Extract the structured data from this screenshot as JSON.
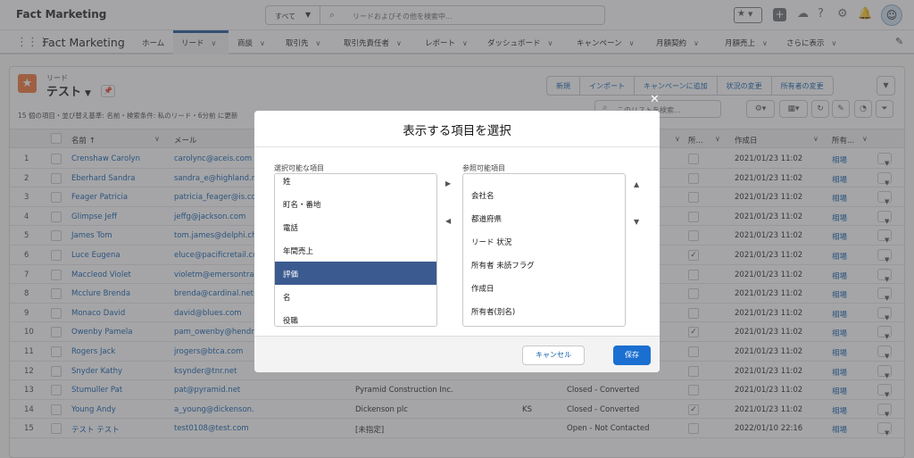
{
  "header": {
    "org_name": "Fact Marketing",
    "search_scope": "すべて",
    "search_placeholder": "リードおよびその他を検索中..."
  },
  "nav": {
    "app_name": "Fact Marketing",
    "tabs": [
      "ホーム",
      "リード",
      "商談",
      "取引先",
      "取引先責任者",
      "レポート",
      "ダッシュボード",
      "キャンペーン",
      "月額契約",
      "月額売上",
      "さらに表示"
    ]
  },
  "listview": {
    "object_label": "リード",
    "name": "テスト",
    "summary": "15 個の項目・並び替え基準: 名前・検索条件: 私のリード・6分前 に更新",
    "actions": [
      "新規",
      "インポート",
      "キャンペーンに追加",
      "状況の変更",
      "所有者の変更"
    ],
    "search_placeholder": "このリストを検索...",
    "columns": {
      "name": "名前 ↑",
      "email": "メール",
      "owner_flag": "所...",
      "created": "作成日",
      "owner": "所有..."
    },
    "rows": [
      {
        "n": "1",
        "name": "Crenshaw Carolyn",
        "email": "carolync@aceis.com",
        "company": "",
        "state": "",
        "status": "",
        "flag": false,
        "created": "2021/01/23 11:02",
        "owner": "相場"
      },
      {
        "n": "2",
        "name": "Eberhard Sandra",
        "email": "sandra_e@highland.net",
        "company": "",
        "state": "",
        "status": "",
        "flag": false,
        "created": "2021/01/23 11:02",
        "owner": "相場"
      },
      {
        "n": "3",
        "name": "Feager Patricia",
        "email": "patricia_feager@is.com",
        "company": "",
        "state": "",
        "status": "",
        "flag": false,
        "created": "2021/01/23 11:02",
        "owner": "相場"
      },
      {
        "n": "4",
        "name": "Glimpse Jeff",
        "email": "jeffg@jackson.com",
        "company": "",
        "state": "",
        "status": "",
        "flag": false,
        "created": "2021/01/23 11:02",
        "owner": "相場"
      },
      {
        "n": "5",
        "name": "James Tom",
        "email": "tom.james@delphi.chemicals.com",
        "company": "",
        "state": "",
        "status": "",
        "flag": false,
        "created": "2021/01/23 11:02",
        "owner": "相場"
      },
      {
        "n": "6",
        "name": "Luce Eugena",
        "email": "eluce@pacificretail.com",
        "company": "",
        "state": "",
        "status": "",
        "flag": true,
        "created": "2021/01/23 11:02",
        "owner": "相場"
      },
      {
        "n": "7",
        "name": "Maccleod Violet",
        "email": "violetm@emersontransport.com",
        "company": "",
        "state": "",
        "status": "",
        "flag": false,
        "created": "2021/01/23 11:02",
        "owner": "相場"
      },
      {
        "n": "8",
        "name": "Mcclure Brenda",
        "email": "brenda@cardinal.net",
        "company": "",
        "state": "",
        "status": "",
        "flag": false,
        "created": "2021/01/23 11:02",
        "owner": "相場"
      },
      {
        "n": "9",
        "name": "Monaco David",
        "email": "david@blues.com",
        "company": "",
        "state": "",
        "status": "",
        "flag": false,
        "created": "2021/01/23 11:02",
        "owner": "相場"
      },
      {
        "n": "10",
        "name": "Owenby Pamela",
        "email": "pam_owenby@hendrickson.com",
        "company": "",
        "state": "",
        "status": "",
        "flag": true,
        "created": "2021/01/23 11:02",
        "owner": "相場"
      },
      {
        "n": "11",
        "name": "Rogers Jack",
        "email": "jrogers@btca.com",
        "company": "",
        "state": "",
        "status": "",
        "flag": false,
        "created": "2021/01/23 11:02",
        "owner": "相場"
      },
      {
        "n": "12",
        "name": "Snyder Kathy",
        "email": "ksynder@tnr.net",
        "company": "",
        "state": "",
        "status": "",
        "flag": false,
        "created": "2021/01/23 11:02",
        "owner": "相場"
      },
      {
        "n": "13",
        "name": "Stumuller Pat",
        "email": "pat@pyramid.net",
        "company": "Pyramid Construction Inc.",
        "state": "",
        "status": "Closed - Converted",
        "flag": false,
        "created": "2021/01/23 11:02",
        "owner": "相場"
      },
      {
        "n": "14",
        "name": "Young Andy",
        "email": "a_young@dickenson.com",
        "company": "Dickenson plc",
        "state": "KS",
        "status": "Closed - Converted",
        "flag": true,
        "created": "2021/01/23 11:02",
        "owner": "相場"
      },
      {
        "n": "15",
        "name": "テスト テスト",
        "email": "test0108@test.com",
        "company": "[未指定]",
        "state": "",
        "status": "Open - Not Contacted",
        "flag": false,
        "created": "2022/01/10 22:16",
        "owner": "相場"
      }
    ]
  },
  "modal": {
    "title": "表示する項目を選択",
    "available_label": "選択可能な項目",
    "available": [
      "姓",
      "町名・番地",
      "電話",
      "年間売上",
      "評価",
      "名",
      "役職"
    ],
    "selected_available": "評価",
    "visible_label": "参照可能項目",
    "visible": [
      "会社名",
      "都道府県",
      "リード 状況",
      "所有者 未読フラグ",
      "作成日",
      "所有者(別名)"
    ],
    "cancel": "キャンセル",
    "save": "保存"
  }
}
